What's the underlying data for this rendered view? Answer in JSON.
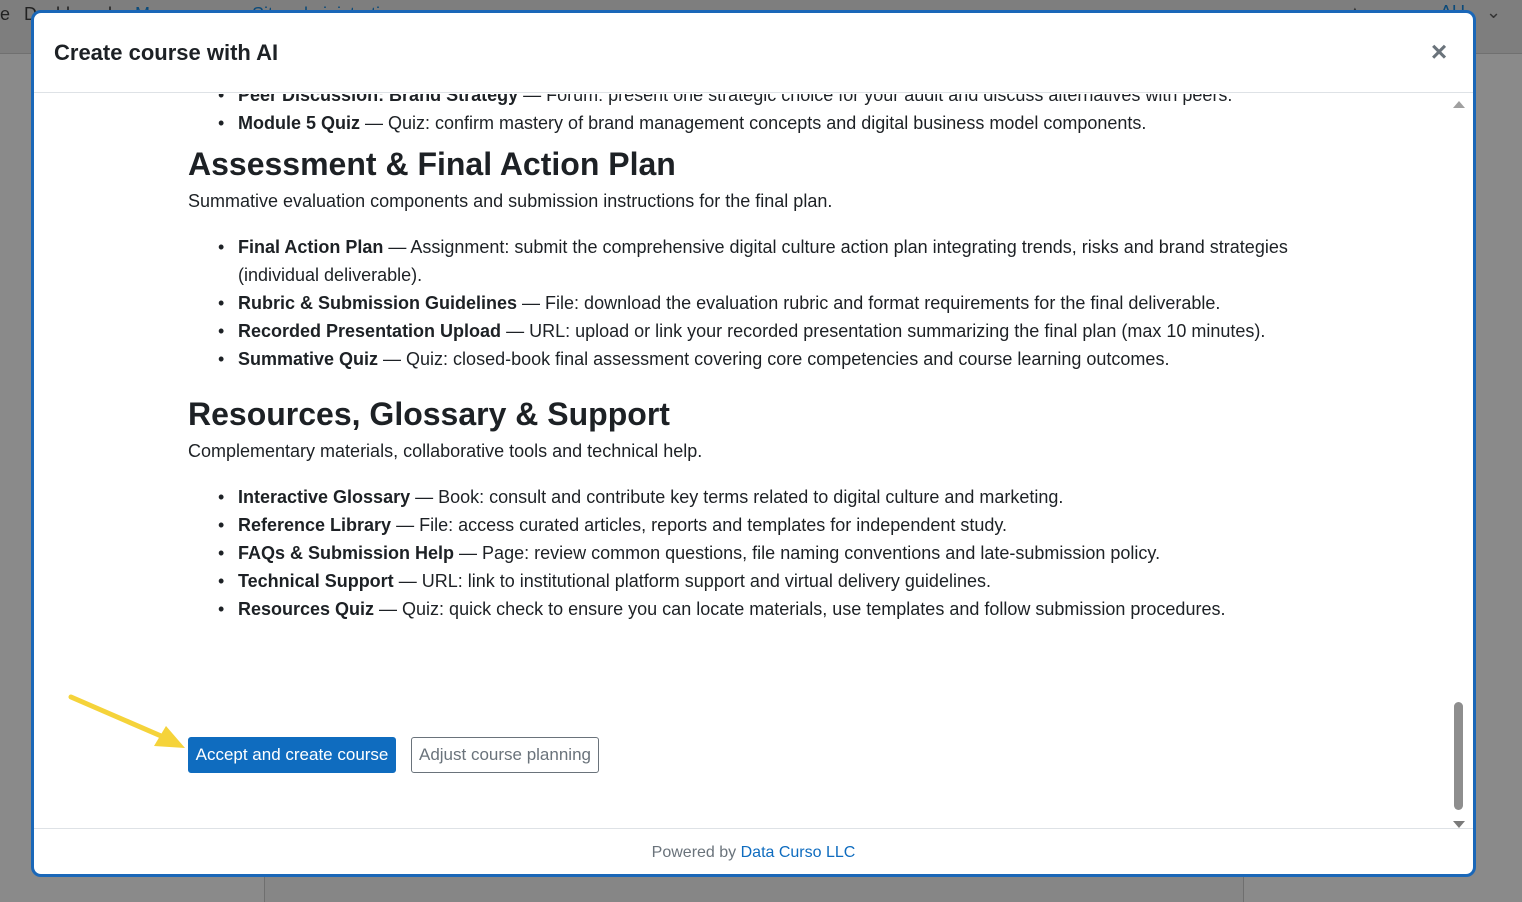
{
  "background": {
    "nav_first": "e",
    "nav_dashboard": "Dashboard",
    "nav_my_courses": "My courses",
    "nav_site_admin": "Site administration",
    "user_initials": "AU"
  },
  "modal": {
    "title": "Create course with AI",
    "close_label": "×"
  },
  "top_items": [
    {
      "bold": "Peer Discussion: Brand Strategy",
      "text": " — Forum: present one strategic choice for your audit and discuss alternatives with peers."
    },
    {
      "bold": "Module 5 Quiz",
      "text": " — Quiz: confirm mastery of brand management concepts and digital business model components."
    }
  ],
  "sections": [
    {
      "title": "Assessment & Final Action Plan",
      "description": "Summative evaluation components and submission instructions for the final plan.",
      "items": [
        {
          "bold": "Final Action Plan",
          "text": " — Assignment: submit the comprehensive digital culture action plan integrating trends, risks and brand strategies (individual deliverable)."
        },
        {
          "bold": "Rubric & Submission Guidelines",
          "text": " — File: download the evaluation rubric and format requirements for the final deliverable."
        },
        {
          "bold": "Recorded Presentation Upload",
          "text": " — URL: upload or link your recorded presentation summarizing the final plan (max 10 minutes)."
        },
        {
          "bold": "Summative Quiz",
          "text": " — Quiz: closed-book final assessment covering core competencies and course learning outcomes."
        }
      ]
    },
    {
      "title": "Resources, Glossary & Support",
      "description": "Complementary materials, collaborative tools and technical help.",
      "items": [
        {
          "bold": "Interactive Glossary",
          "text": " — Book: consult and contribute key terms related to digital culture and marketing."
        },
        {
          "bold": "Reference Library",
          "text": " — File: access curated articles, reports and templates for independent study."
        },
        {
          "bold": "FAQs & Submission Help",
          "text": " — Page: review common questions, file naming conventions and late-submission policy."
        },
        {
          "bold": "Technical Support",
          "text": " — URL: link to institutional platform support and virtual delivery guidelines."
        },
        {
          "bold": "Resources Quiz",
          "text": " — Quiz: quick check to ensure you can locate materials, use templates and follow submission procedures."
        }
      ]
    }
  ],
  "actions": {
    "accept_label": "Accept and create course",
    "adjust_label": "Adjust course planning"
  },
  "footer": {
    "prefix": "Powered by ",
    "link_text": "Data Curso LLC"
  },
  "colors": {
    "primary": "#0f6cbf",
    "modal_border": "#1a67b8",
    "arrow": "#f5d33a"
  }
}
